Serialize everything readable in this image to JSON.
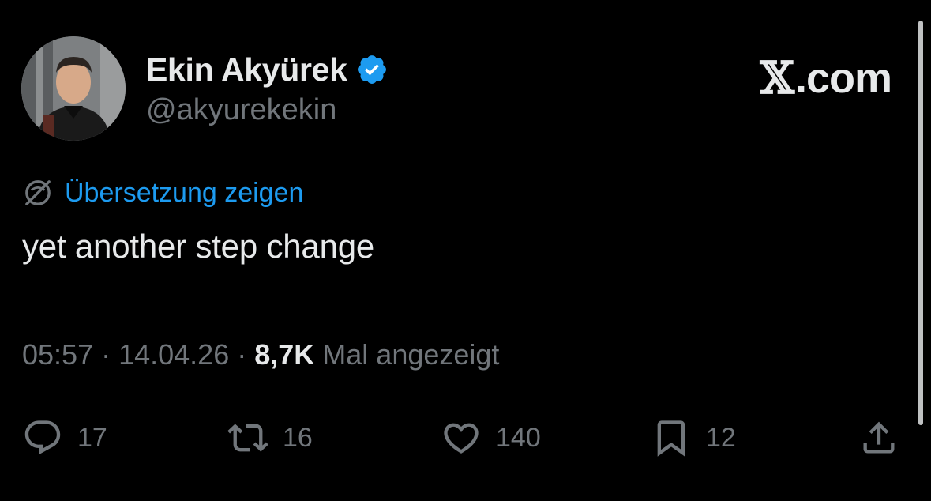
{
  "author": {
    "display_name": "Ekin Akyürek",
    "handle": "@akyurekekin",
    "verified": true
  },
  "brand": {
    "mark": "𝕏",
    "suffix": ".com"
  },
  "translate": {
    "label": "Übersetzung zeigen",
    "icon": "globe-slash-icon"
  },
  "tweet": {
    "text": "yet another step change"
  },
  "meta": {
    "time": "05:57",
    "separator": " · ",
    "date": "14.04.26",
    "views_count": "8,7K",
    "views_label": " Mal angezeigt"
  },
  "actions": {
    "reply": {
      "icon": "reply-icon",
      "count": "17"
    },
    "repost": {
      "icon": "repost-icon",
      "count": "16"
    },
    "like": {
      "icon": "heart-icon",
      "count": "140"
    },
    "bookmark": {
      "icon": "bookmark-icon",
      "count": "12"
    },
    "share": {
      "icon": "share-icon"
    }
  },
  "colors": {
    "background": "#000000",
    "primary_text": "#e7e9ea",
    "secondary_text": "#71767b",
    "accent": "#1d9bf0"
  }
}
